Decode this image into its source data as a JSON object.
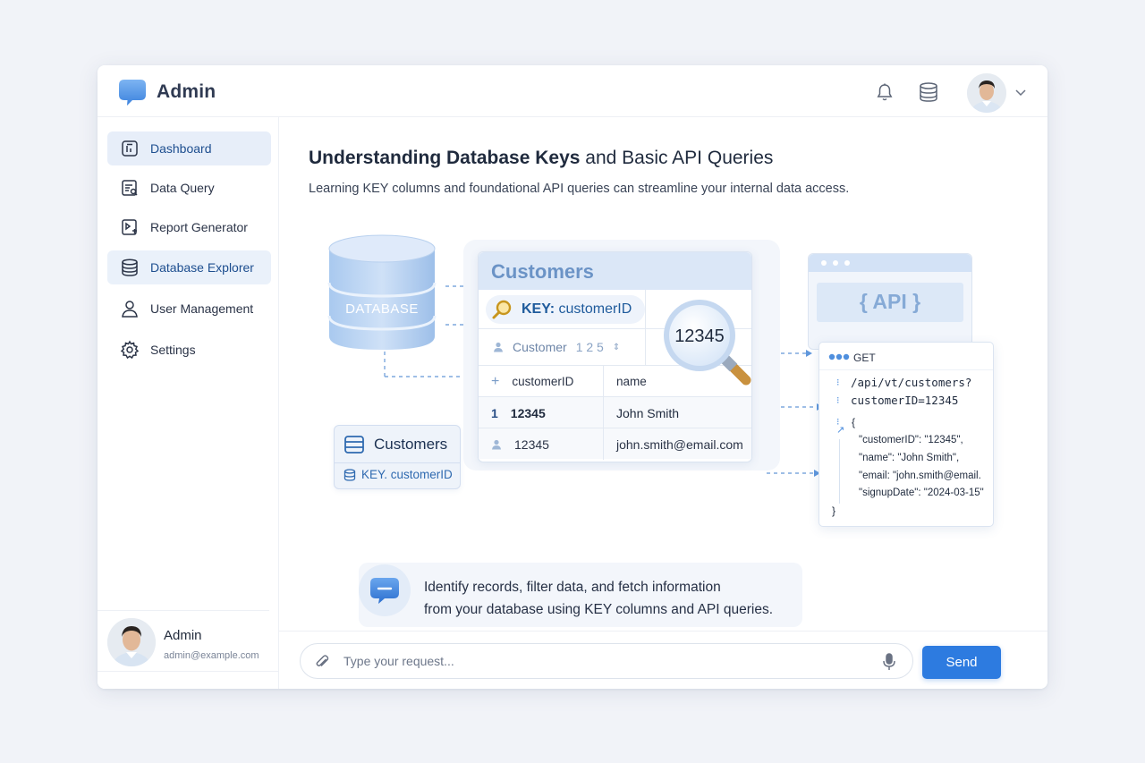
{
  "app": {
    "title": "Admin",
    "accent_color": "#2d7be0"
  },
  "header": {
    "notifications_icon": "bell-icon",
    "database_icon": "database-icon",
    "user_menu_icon": "chevron-down-icon"
  },
  "sidebar": {
    "items": [
      {
        "label": "Dashboard",
        "icon": "dashboard-icon"
      },
      {
        "label": "Data Query",
        "icon": "data-query-icon"
      },
      {
        "label": "Report Generator",
        "icon": "report-icon"
      },
      {
        "label": "Database Explorer",
        "icon": "database-icon"
      },
      {
        "label": "User Management",
        "icon": "user-icon"
      },
      {
        "label": "Settings",
        "icon": "gear-icon"
      }
    ],
    "profile": {
      "name": "Admin",
      "email": "admin@example.com"
    }
  },
  "main": {
    "heading_bold": "Understanding Database Keys",
    "heading_rest": " and Basic API Queries",
    "subtext": "Learning KEY columns and foundational API queries can streamline your internal data access.",
    "illustration": {
      "database_label": "DATABASE",
      "mini_card": {
        "title": "Customers",
        "key": "KEY. customerID"
      },
      "table": {
        "title": "Customers",
        "key_label_bold": "KEY:",
        "key_label_rest": " customerID",
        "customer_row_label": "Customer",
        "customer_row_digits": "1 2 5",
        "magnified_value": "12345",
        "columns": [
          "customerID",
          "name"
        ],
        "header_marker": "+",
        "rows": [
          {
            "marker": "1",
            "id": "12345",
            "value": "John Smith"
          },
          {
            "marker": "person",
            "id": "12345",
            "value": "john.smith@email.com"
          }
        ]
      },
      "api": {
        "label": "{ API }",
        "method": "GET",
        "path_line1": "/api/vt/customers?",
        "path_line2": "customerID=12345",
        "open_brace": "{",
        "json_lines": [
          "\"customerID\": \"12345\",",
          "\"name\": \"John Smith\",",
          "\"email: \"john.smith@email.",
          "\"signupDate\": \"2024-03-15\""
        ],
        "close_brace": "}"
      }
    },
    "info": {
      "line1": "Identify records, filter data, and fetch information",
      "line2": "from your database using KEY columns and API queries."
    }
  },
  "request_bar": {
    "placeholder": "Type your request...",
    "send_label": "Send"
  }
}
